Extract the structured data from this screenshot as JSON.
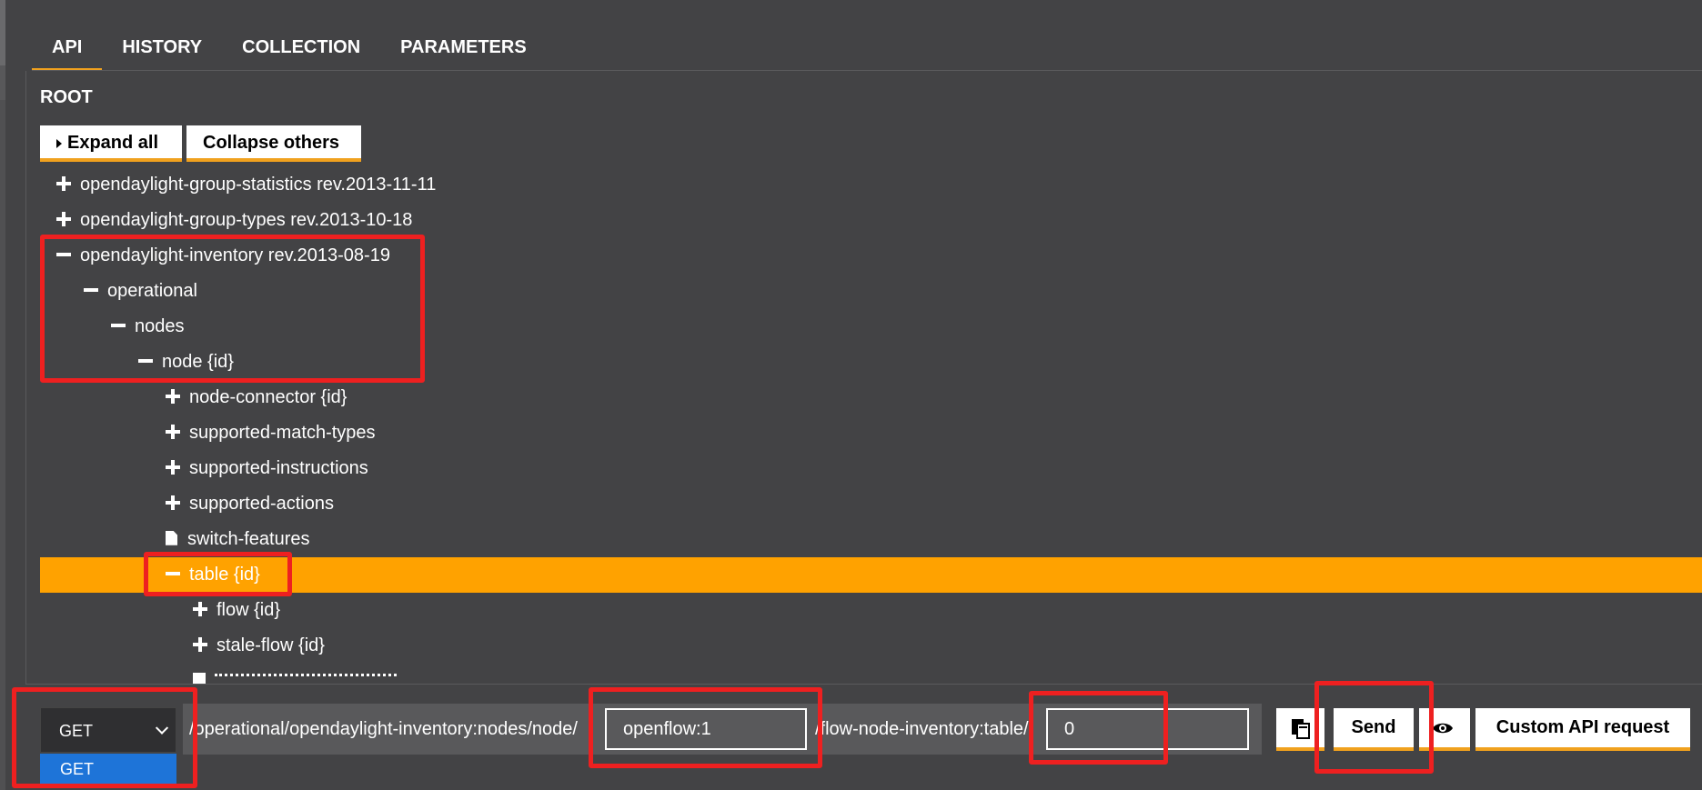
{
  "tabs": [
    {
      "label": "API",
      "active": true
    },
    {
      "label": "HISTORY",
      "active": false
    },
    {
      "label": "COLLECTION",
      "active": false
    },
    {
      "label": "PARAMETERS",
      "active": false
    }
  ],
  "root_label": "ROOT",
  "buttons": {
    "expand_all": "Expand all",
    "collapse_others": "Collapse others"
  },
  "tree": [
    {
      "icon": "plus-icon",
      "label": "opendaylight-group-statistics rev.2013-11-11"
    },
    {
      "icon": "plus-icon",
      "label": "opendaylight-group-types rev.2013-10-18"
    },
    {
      "icon": "minus-icon",
      "label": "opendaylight-inventory rev.2013-08-19"
    },
    {
      "icon": "minus-icon",
      "label": "operational"
    },
    {
      "icon": "minus-icon",
      "label": "nodes"
    },
    {
      "icon": "minus-icon",
      "label": "node {id}"
    },
    {
      "icon": "plus-icon",
      "label": "node-connector {id}"
    },
    {
      "icon": "plus-icon",
      "label": "supported-match-types"
    },
    {
      "icon": "plus-icon",
      "label": "supported-instructions"
    },
    {
      "icon": "plus-icon",
      "label": "supported-actions"
    },
    {
      "icon": "file-icon",
      "label": "switch-features"
    },
    {
      "icon": "minus-icon",
      "label": "table {id}",
      "selected": true
    },
    {
      "icon": "plus-icon",
      "label": "flow {id}"
    },
    {
      "icon": "plus-icon",
      "label": "stale-flow {id}"
    }
  ],
  "request": {
    "method": "GET",
    "method_option": "GET",
    "url_part1": "/operational/opendaylight-inventory:nodes/node/",
    "node_id": "openflow:1",
    "url_part2": "/flow-node-inventory:table/",
    "table_id": "0",
    "send_label": "Send",
    "custom_label": "Custom API request"
  },
  "colors": {
    "accent": "#ffa200",
    "highlight": "#ee2020",
    "background": "#434345",
    "select_option": "#1e74d8"
  }
}
